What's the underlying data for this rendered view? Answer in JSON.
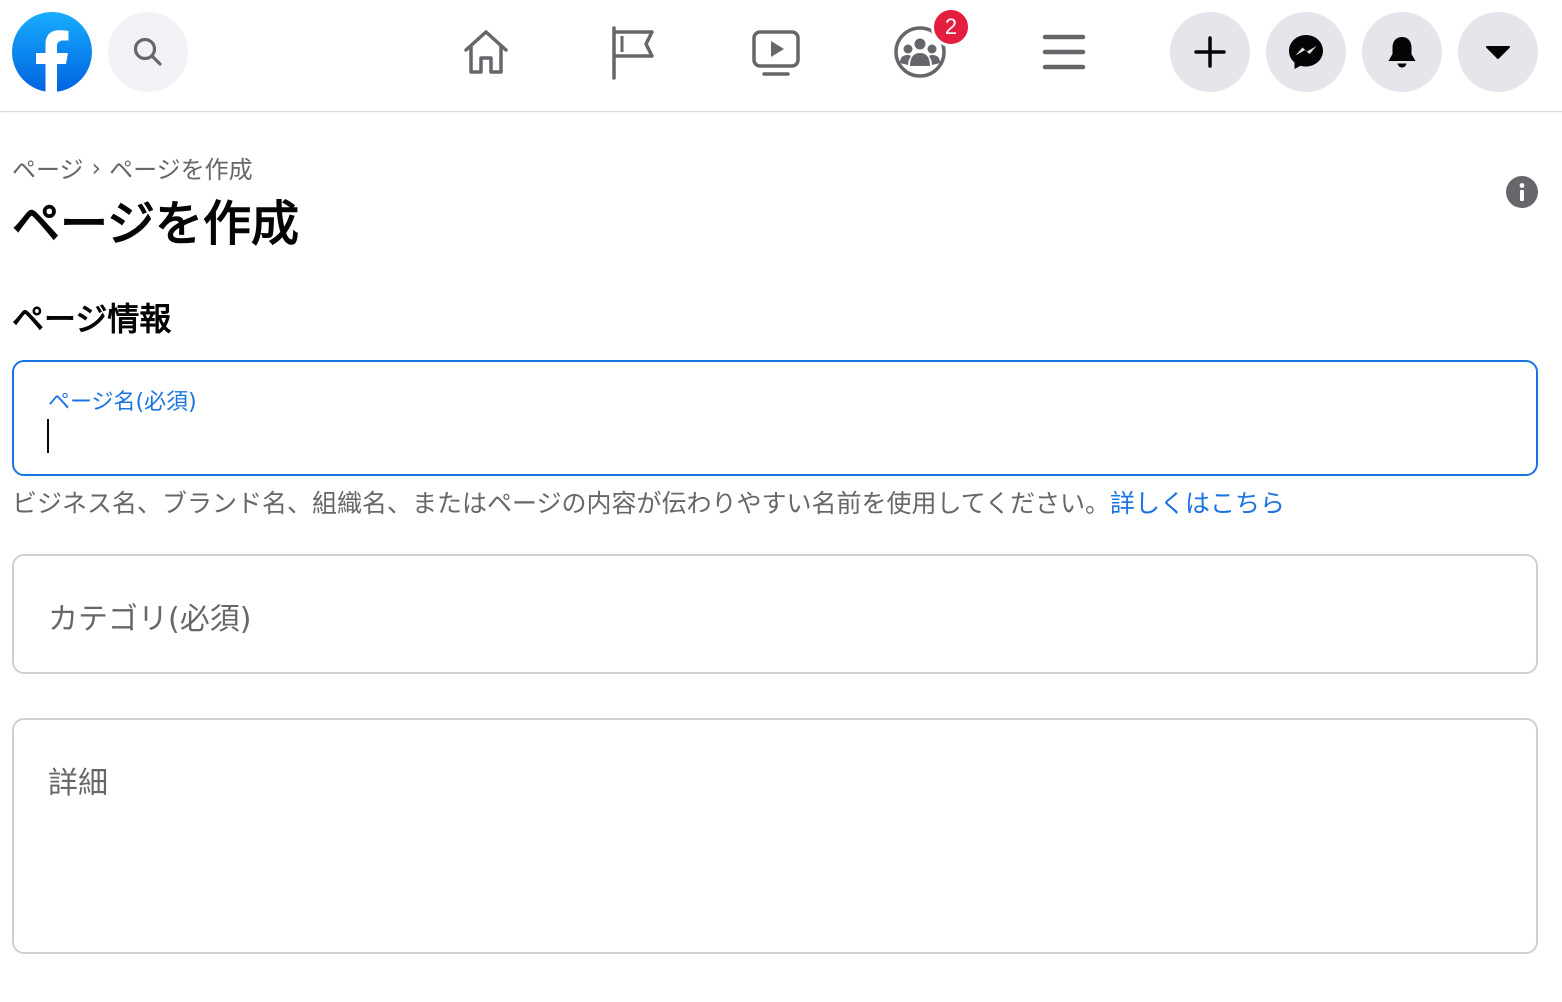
{
  "header": {
    "notification_badge": "2",
    "colors": {
      "brand": "#1877f2",
      "badge": "#e41e3f",
      "icon_bg": "#e4e6eb"
    },
    "icons": [
      "facebook-logo",
      "search-icon",
      "home-icon",
      "flag-icon",
      "watch-icon",
      "groups-icon",
      "menu-icon",
      "plus-icon",
      "messenger-icon",
      "bell-icon",
      "caret-down-icon"
    ]
  },
  "breadcrumb": {
    "parent": "ページ",
    "separator": "›",
    "current": "ページを作成"
  },
  "page": {
    "title": "ページを作成",
    "section_title": "ページ情報"
  },
  "form": {
    "page_name": {
      "label": "ページ名(必須)",
      "value": ""
    },
    "helper_text": "ビジネス名、ブランド名、組織名、またはページの内容が伝わりやすい名前を使用してください。",
    "helper_link": "詳しくはこちら",
    "category": {
      "placeholder": "カテゴリ(必須)"
    },
    "details": {
      "placeholder": "詳細"
    }
  }
}
